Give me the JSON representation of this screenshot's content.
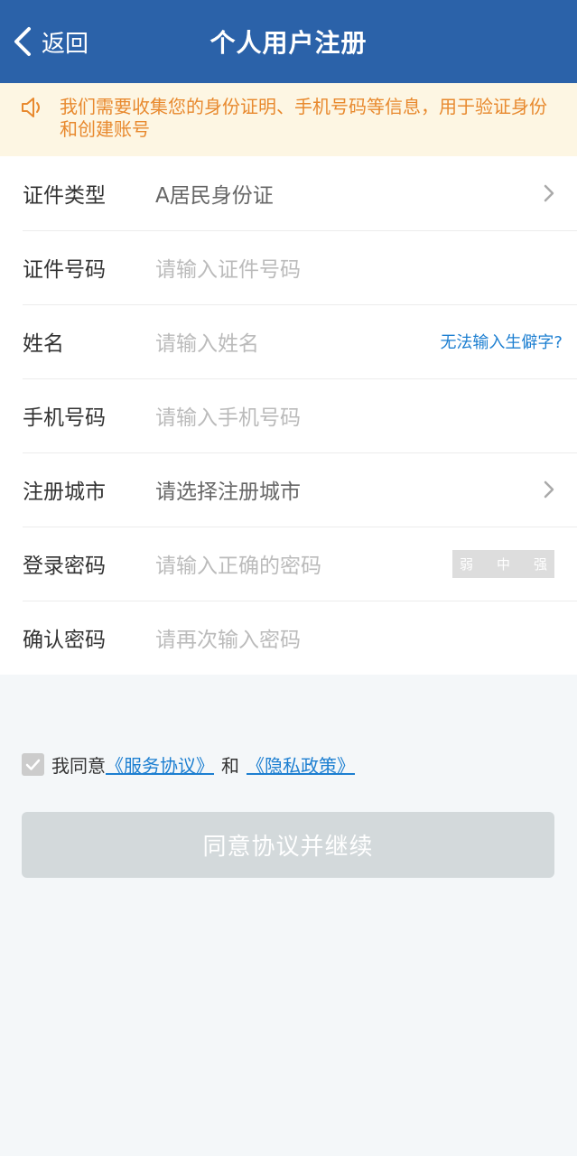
{
  "header": {
    "back_label": "返回",
    "title": "个人用户注册"
  },
  "notice": {
    "text": "我们需要收集您的身份证明、手机号码等信息，用于验证身份和创建账号"
  },
  "form": {
    "id_type": {
      "label": "证件类型",
      "value": "A居民身份证"
    },
    "id_number": {
      "label": "证件号码",
      "placeholder": "请输入证件号码"
    },
    "name": {
      "label": "姓名",
      "placeholder": "请输入姓名",
      "rare_char_link": "无法输入生僻字?"
    },
    "phone": {
      "label": "手机号码",
      "placeholder": "请输入手机号码"
    },
    "city": {
      "label": "注册城市",
      "value": "请选择注册城市"
    },
    "password": {
      "label": "登录密码",
      "placeholder": "请输入正确的密码",
      "strength": [
        "弱",
        "中",
        "强"
      ]
    },
    "confirm": {
      "label": "确认密码",
      "placeholder": "请再次输入密码"
    }
  },
  "agreement": {
    "prefix": "我同意",
    "service": "《服务协议》",
    "and": "和",
    "privacy": "《隐私政策》",
    "checked": true
  },
  "submit": {
    "label": "同意协议并继续"
  },
  "colors": {
    "header": "#2b62a9",
    "notice_bg": "#fdf6e3",
    "notice_text": "#e8892e",
    "link": "#1d7fd1",
    "button_disabled": "#d3d9db"
  }
}
